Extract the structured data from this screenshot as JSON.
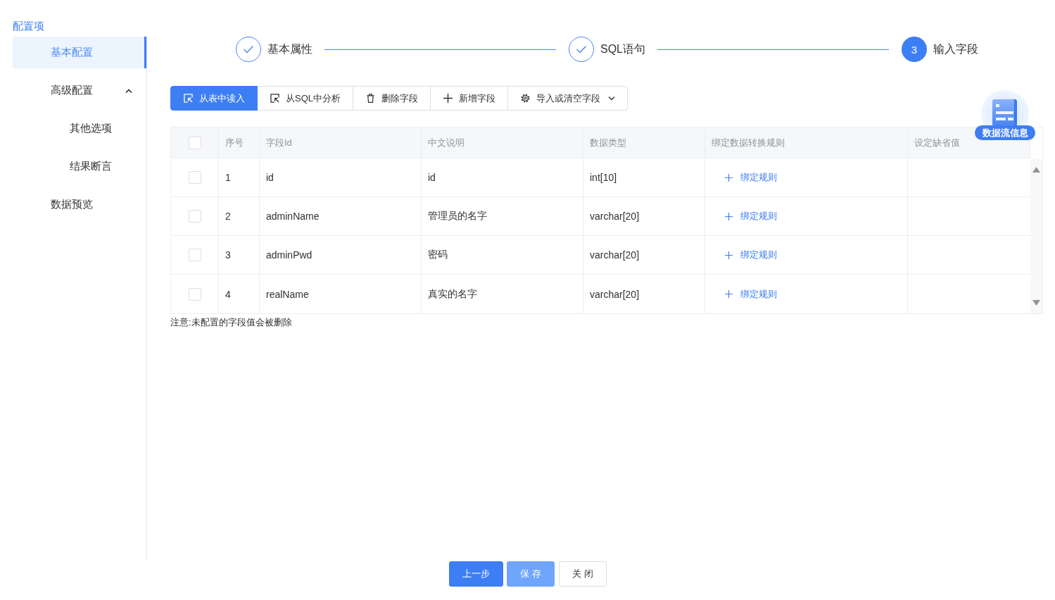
{
  "sidebar": {
    "title": "配置项",
    "items": [
      {
        "label": "基本配置",
        "selected": true
      },
      {
        "label": "高级配置",
        "selected": false,
        "expanded": true,
        "children": [
          {
            "label": "其他选项",
            "selected": false
          },
          {
            "label": "结果断言",
            "selected": false
          }
        ]
      },
      {
        "label": "数据预览",
        "selected": false
      }
    ]
  },
  "steps": [
    {
      "label": "基本属性",
      "kind": "finished"
    },
    {
      "label": "SQL语句",
      "kind": "finished"
    },
    {
      "label": "输入字段",
      "number": "3",
      "kind": "active"
    }
  ],
  "toolbar": {
    "buttons": [
      {
        "label": "从表中读入",
        "kind": "import",
        "primary": true,
        "dropdown": false
      },
      {
        "label": "从SQL中分析",
        "kind": "analyze",
        "primary": false,
        "dropdown": false
      },
      {
        "label": "删除字段",
        "kind": "delete",
        "primary": false,
        "dropdown": false
      },
      {
        "label": "新增字段",
        "kind": "add",
        "primary": false,
        "dropdown": false
      },
      {
        "label": "导入或清空字段",
        "kind": "manage",
        "primary": false,
        "dropdown": true
      }
    ]
  },
  "float_button": {
    "label": "数据流信息"
  },
  "table": {
    "select_all_checked": false,
    "columns": [
      "序号",
      "字段Id",
      "中文说明",
      "数据类型",
      "绑定数据转换规则",
      "设定缺省值"
    ],
    "rows": [
      {
        "checked": false,
        "index": "1",
        "field_id": "id",
        "description": "id",
        "data_type": "int[10]",
        "rule_action": "绑定规则"
      },
      {
        "checked": false,
        "index": "2",
        "field_id": "adminName",
        "description": "管理员的名字",
        "data_type": "varchar[20]",
        "rule_action": "绑定规则"
      },
      {
        "checked": false,
        "index": "3",
        "field_id": "adminPwd",
        "description": "密码",
        "data_type": "varchar[20]",
        "rule_action": "绑定规则"
      },
      {
        "checked": false,
        "index": "4",
        "field_id": "realName",
        "description": "真实的名字",
        "data_type": "varchar[20]",
        "rule_action": "绑定规则"
      }
    ]
  },
  "note": "注意:未配置的字段值会被删除",
  "footer": {
    "buttons": [
      {
        "label": "上一步",
        "kind": "primary",
        "disabled": false
      },
      {
        "label": "保 存",
        "kind": "primary",
        "disabled": true
      },
      {
        "label": "关 闭",
        "kind": "default",
        "disabled": false
      }
    ]
  }
}
